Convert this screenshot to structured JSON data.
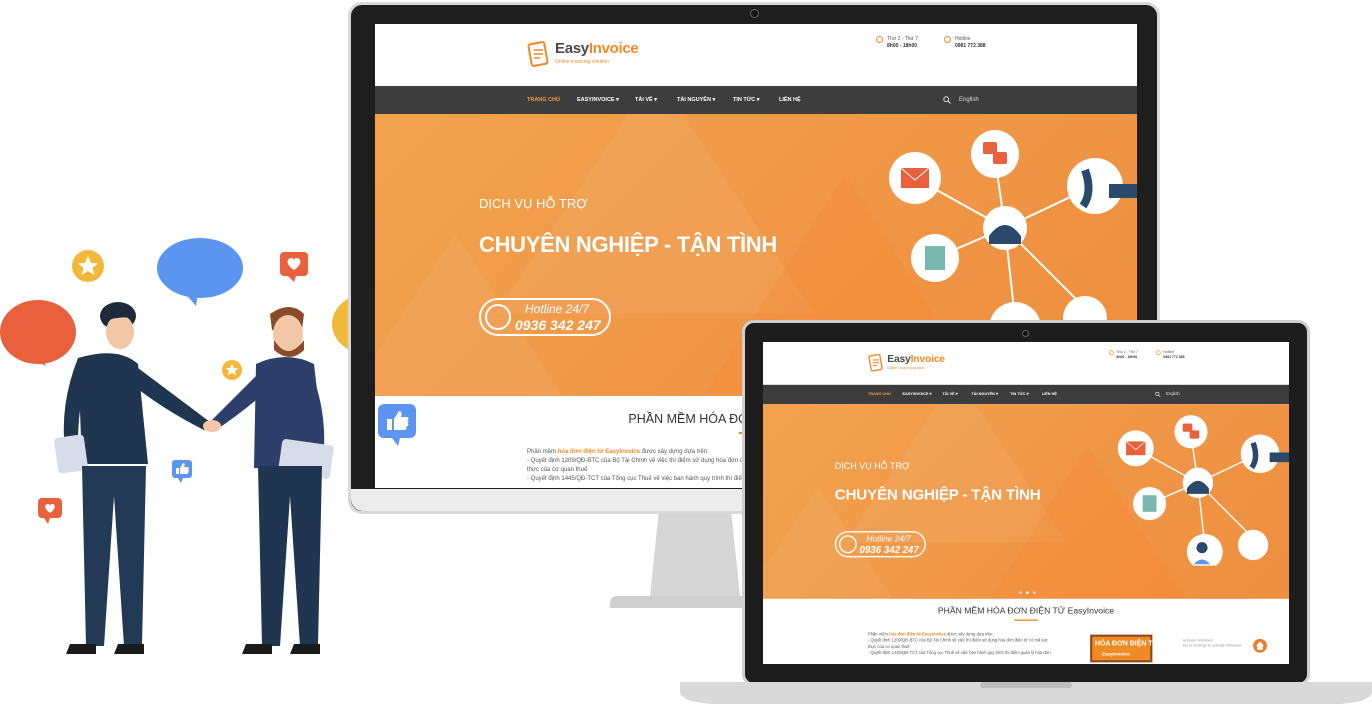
{
  "site": {
    "logo_name_a": "Easy",
    "logo_name_b": "Invoice",
    "logo_tagline": "Online invoicing solution",
    "hours_label": "Thứ 2 - Thứ 7",
    "hours_value": "8h00 - 18h00",
    "hotline_label": "Hotline",
    "hotline_value": "0981 772 388",
    "nav": [
      "TRANG CHỦ",
      "EASYINVOICE ▾",
      "TẢI VỀ ▾",
      "TÀI NGUYÊN ▾",
      "TIN TỨC ▾",
      "LIÊN HỆ"
    ],
    "language": "English",
    "hero_subtitle": "DỊCH VỤ HỖ TRỢ",
    "hero_title": "CHUYÊN NGHIỆP - TẬN TÌNH",
    "hotline_line1": "Hotline 24/7",
    "hotline_line2": "0936 342 247",
    "section_title": "PHẦN MỀM HÓA ĐƠN ĐIỆN TỬ EasyInvoice",
    "body_intro_a": "Phần mềm ",
    "body_intro_link": "hóa đơn điện tử EasyInvoice",
    "body_intro_b": " được xây dựng dựa trên:",
    "body_line2": "- Quyết định 1209/QĐ-BTC của Bộ Tài Chính về việc thí điểm sử dụng hóa đơn điện tử có mã xác",
    "body_line3": "thực của cơ quan thuế",
    "body_line4": "- Quyết định 1445/QĐ-TCT của Tổng cục Thuế về việc ban hành quy trình thí điểm quản lý hóa đơn",
    "poster_title": "HÓA ĐƠN ĐIỆN TỬ",
    "poster_brand": "EasyInvoice",
    "activate_line1": "Activate Windows",
    "activate_line2": "Go to Settings to activate Windows."
  },
  "colors": {
    "brand_orange": "#f08a24",
    "nav_bg": "#3d3d3d",
    "hero_bg": "#f09a4a",
    "figure_navy": "#1f3550",
    "bubble_blue": "#5b95f0",
    "bubble_red": "#e8603c",
    "bubble_yellow": "#f2b83b"
  }
}
